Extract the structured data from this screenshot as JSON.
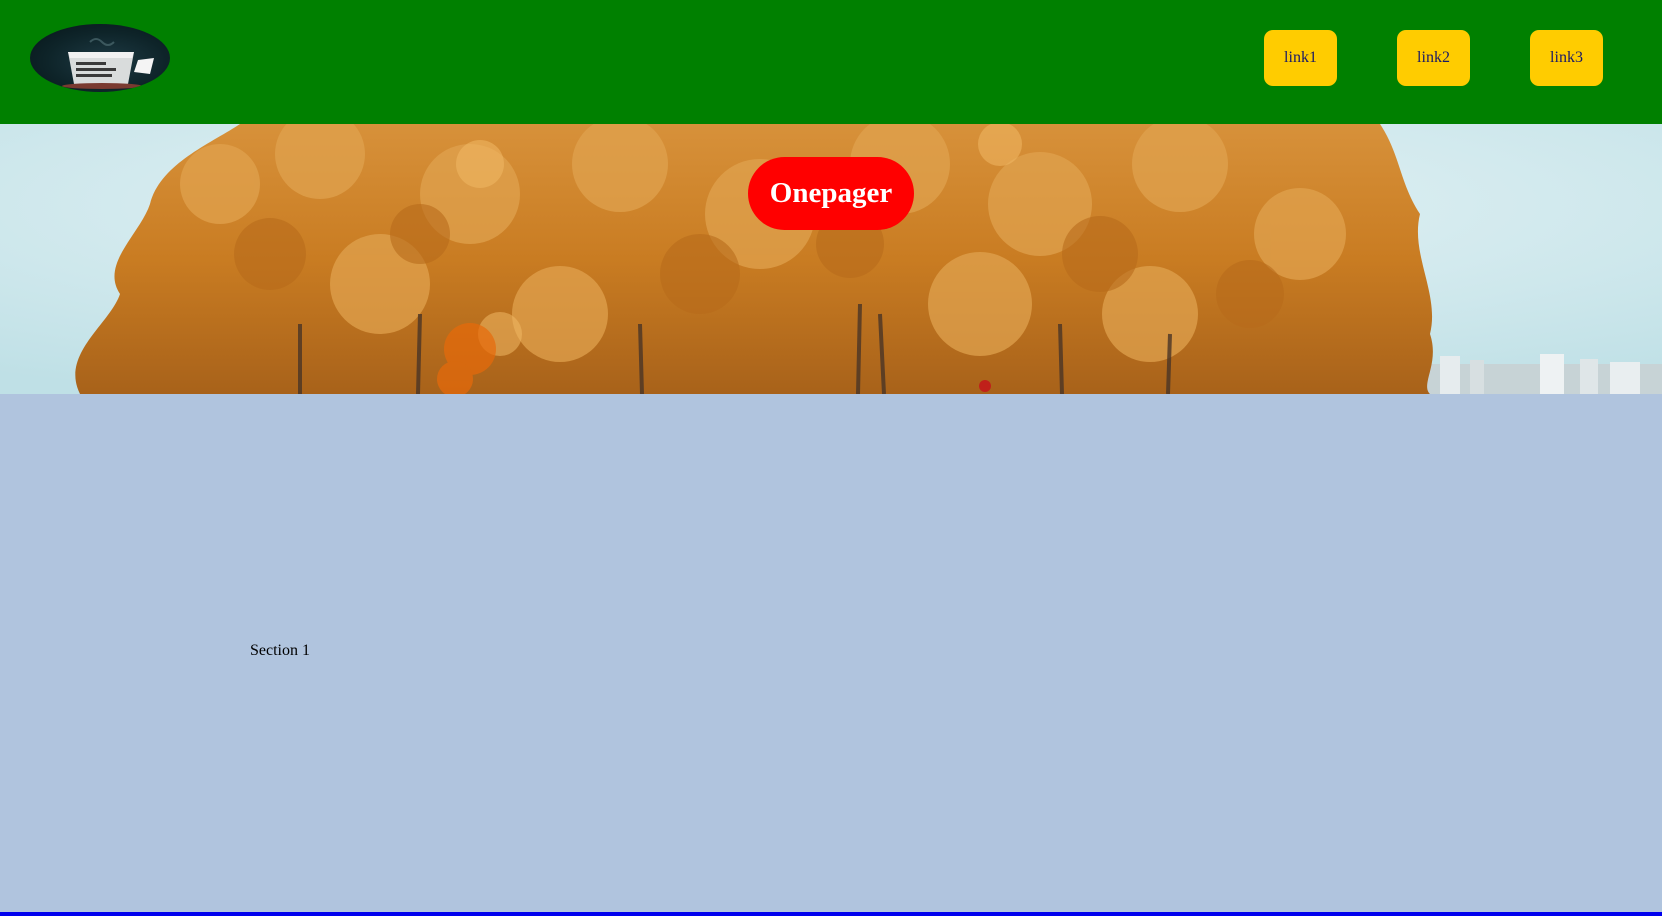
{
  "header": {
    "logo_icon": "coffee-cup-logo",
    "nav_links": [
      {
        "label": "link1"
      },
      {
        "label": "link2"
      },
      {
        "label": "link3"
      }
    ]
  },
  "hero": {
    "title": "Onepager",
    "background": "autumn-trees-photo"
  },
  "section": {
    "label": "Section 1"
  },
  "colors": {
    "header_bg": "#008000",
    "nav_button_bg": "#ffcc00",
    "title_bg": "#ff0000",
    "section_bg": "#b0c4de",
    "bottom_border": "#0000ee"
  }
}
